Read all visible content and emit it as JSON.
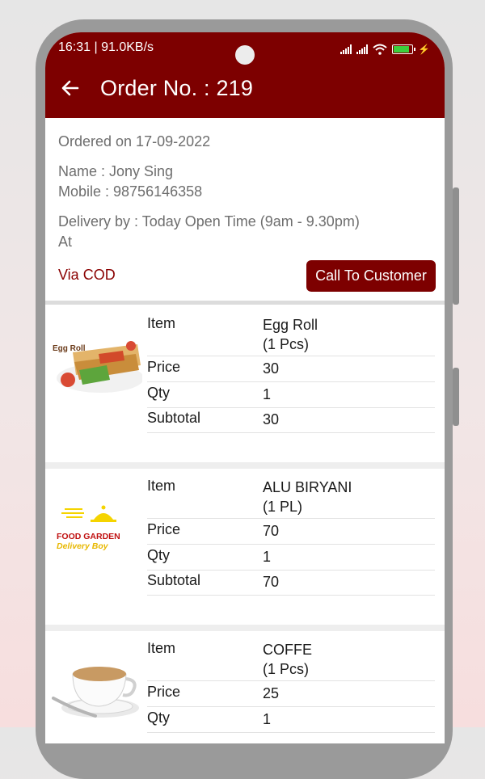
{
  "status": {
    "time_speed": "16:31 | 91.0KB/s"
  },
  "appbar": {
    "title": "Order No. : 219"
  },
  "order": {
    "ordered_on": "Ordered on 17-09-2022",
    "name": "Name : Jony Sing",
    "mobile": "Mobile : 98756146358",
    "delivery": "Delivery by : Today Open Time (9am - 9.30pm)",
    "at": "At",
    "payment": "Via COD",
    "call_button": "Call To Customer"
  },
  "labels": {
    "item": "Item",
    "price": "Price",
    "qty": "Qty",
    "subtotal": "Subtotal"
  },
  "items": [
    {
      "name": "Egg Roll",
      "unit": "(1 Pcs)",
      "price": "30",
      "qty": "1",
      "subtotal": "30",
      "image": "egg-roll-photo",
      "image_text": "Egg Roll"
    },
    {
      "name": "ALU BIRYANI",
      "unit": "(1 PL)",
      "price": "70",
      "qty": "1",
      "subtotal": "70",
      "image": "food-garden-logo",
      "image_text_1": "FOOD GARDEN",
      "image_text_2": "Delivery Boy"
    },
    {
      "name": "COFFE",
      "unit": "(1 Pcs)",
      "price": "25",
      "qty": "1",
      "image": "coffee-cup-photo"
    }
  ],
  "colors": {
    "primary": "#7d0000",
    "accent_text": "#8a0000",
    "muted_text": "#6e6e6e"
  }
}
